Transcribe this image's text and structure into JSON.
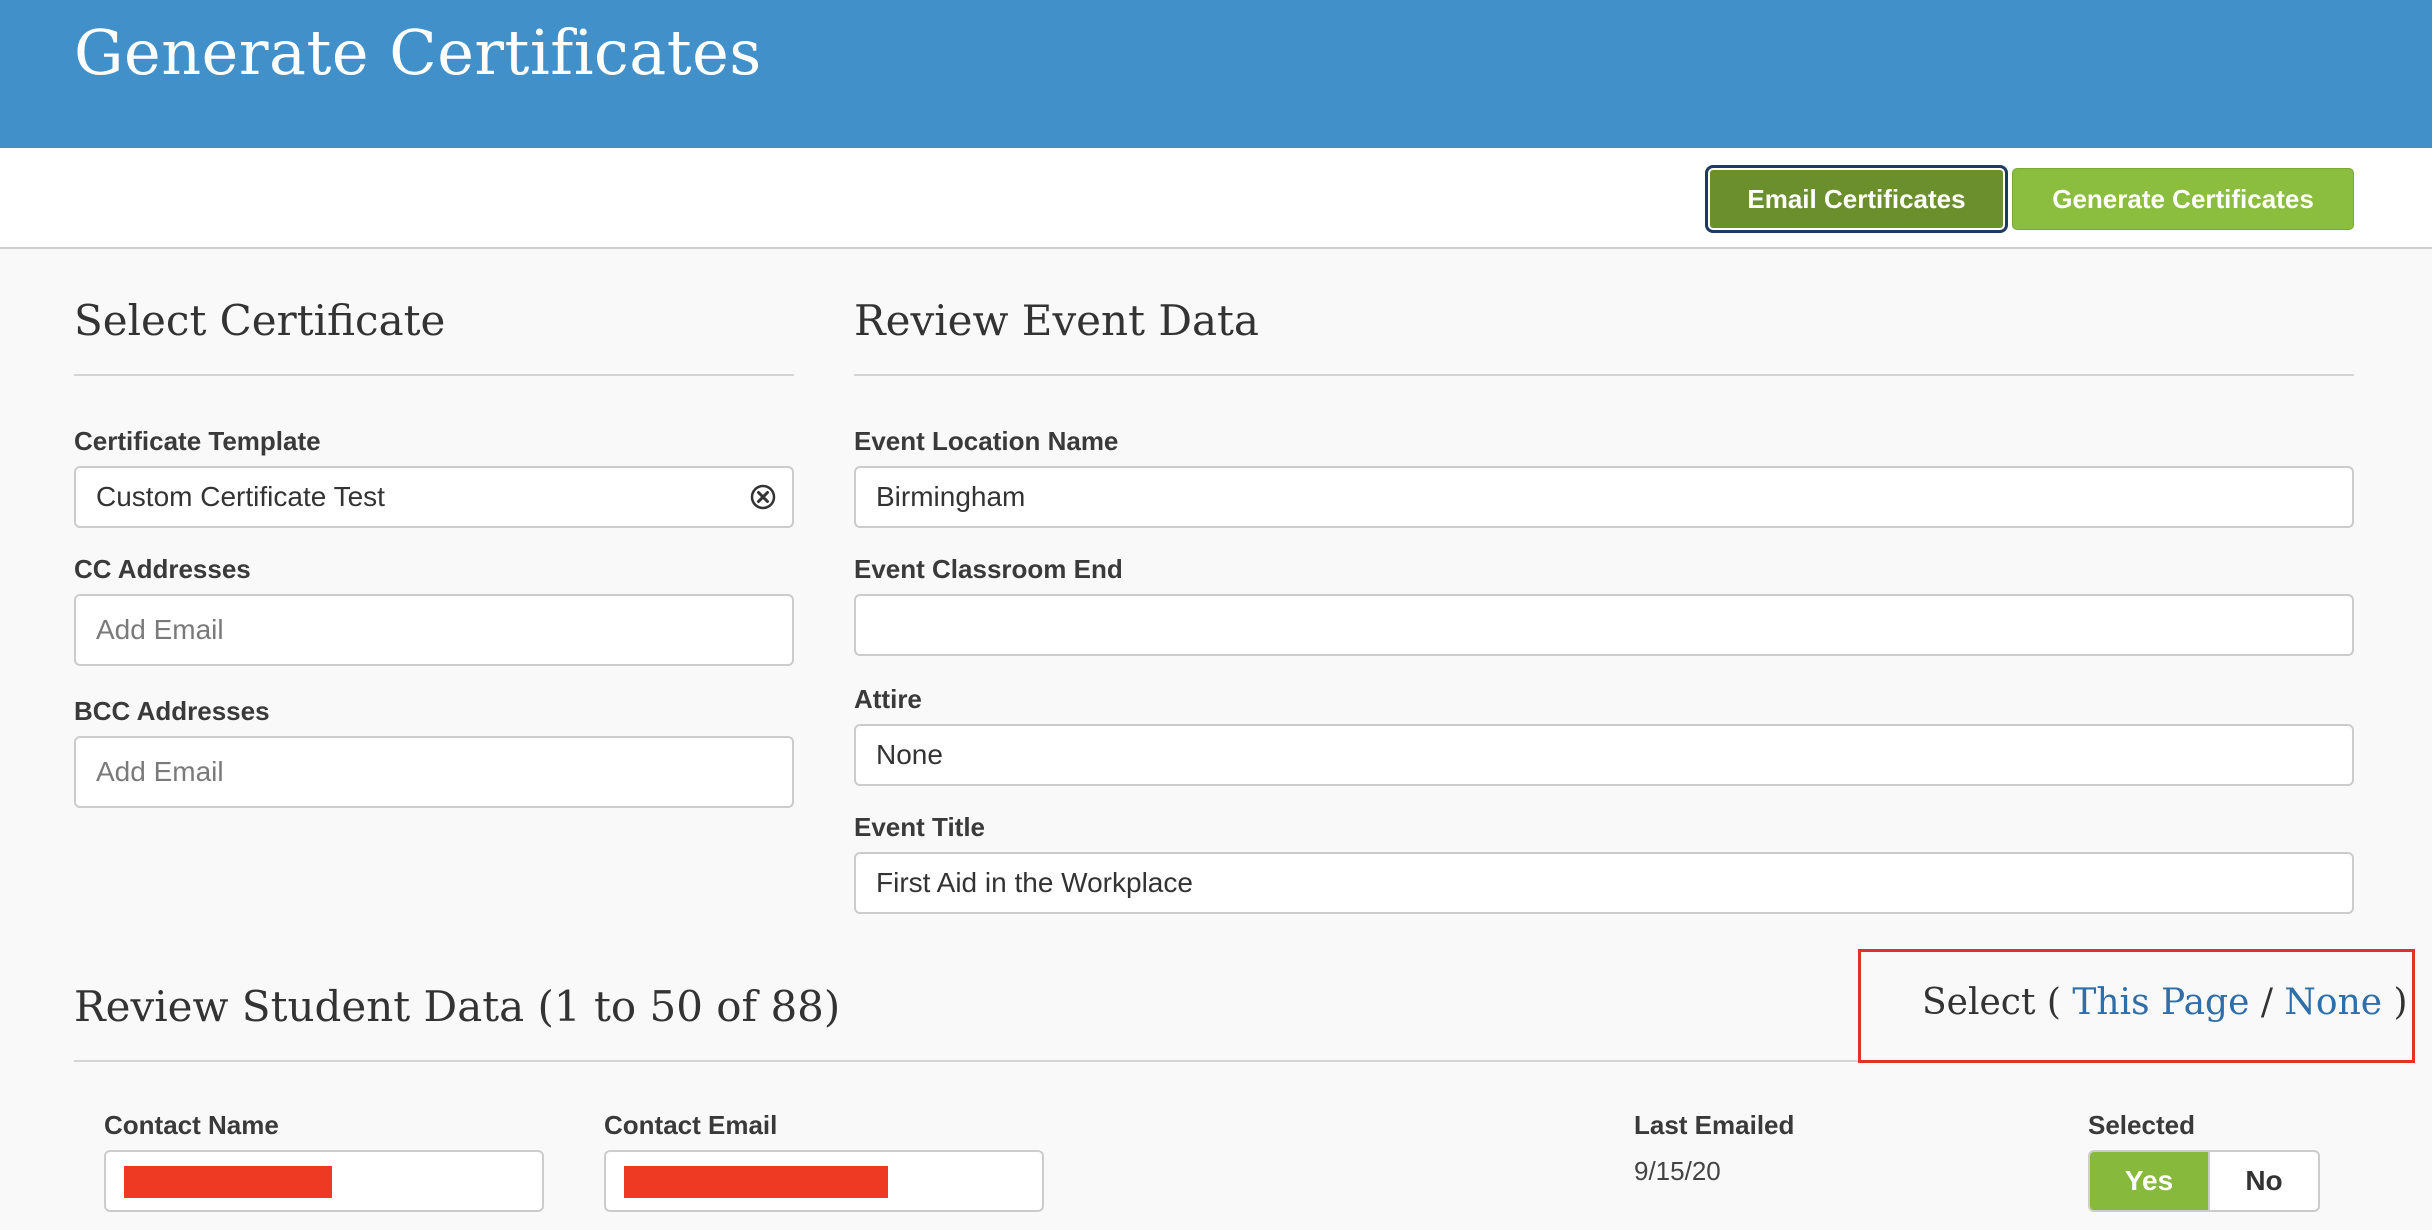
{
  "header": {
    "title": "Generate Certificates"
  },
  "toolbar": {
    "email_label": "Email Certificates",
    "generate_label": "Generate Certificates"
  },
  "select_certificate": {
    "title": "Select Certificate",
    "template_label": "Certificate Template",
    "template_value": "Custom Certificate Test",
    "cc_label": "CC Addresses",
    "cc_placeholder": "Add Email",
    "bcc_label": "BCC Addresses",
    "bcc_placeholder": "Add Email"
  },
  "event_data": {
    "title": "Review Event Data",
    "fields": [
      {
        "label": "Event Location Name",
        "value": "Birmingham"
      },
      {
        "label": "Event Classroom End",
        "value": ""
      },
      {
        "label": "Attire",
        "value": "None"
      },
      {
        "label": "Event Title",
        "value": "First Aid in the Workplace"
      }
    ]
  },
  "student_data": {
    "title": "Review Student Data (1 to 50 of 88)",
    "select_prefix": "Select ( ",
    "select_this_page": "This Page",
    "select_sep": " / ",
    "select_none": "None",
    "select_suffix": " )",
    "columns": {
      "name": "Contact Name",
      "email": "Contact Email",
      "last_emailed": "Last Emailed",
      "selected": "Selected"
    },
    "rows": [
      {
        "last_emailed": "9/15/20",
        "yes_label": "Yes",
        "no_label": "No"
      }
    ]
  },
  "icons": {
    "clear": "clear-circle-x-icon"
  },
  "colors": {
    "header_bg": "#4190ca",
    "email_button": "#6c8f2e",
    "generate_button": "#8bbd3e",
    "highlight_border": "#e0322a",
    "link": "#2f6ea8"
  }
}
